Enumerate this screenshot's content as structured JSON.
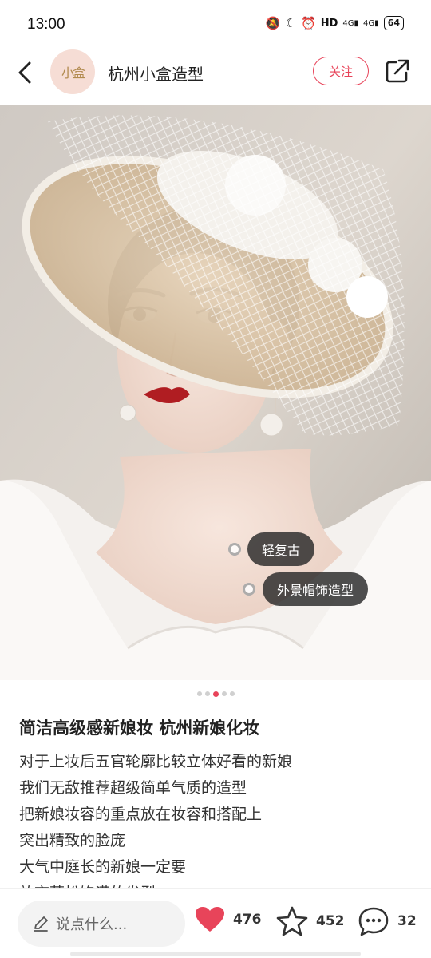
{
  "status_bar": {
    "time": "13:00",
    "network": "HD",
    "signal_1": "4G",
    "signal_2": "4G",
    "battery": "64"
  },
  "header": {
    "account_name": "杭州小盒造型",
    "avatar_text": "小盒",
    "follow_label": "关注"
  },
  "photo": {
    "tags": [
      {
        "label": "轻复古"
      },
      {
        "label": "外景帽饰造型"
      }
    ],
    "pager": {
      "count": 5,
      "active_index": 2
    }
  },
  "post": {
    "title": "简洁高级感新娘妆 杭州新娘化妆",
    "lines": [
      "对于上妆后五官轮廓比较立体好看的新娘",
      "我们无敌推荐超级简单气质的造型",
      "把新娘妆容的重点放在妆容和搭配上",
      "突出精致的脸庞",
      "大气中庭长的新娘一定要",
      "放弃蓬松饱满的发型"
    ]
  },
  "bottom_bar": {
    "comment_placeholder": "说点什么...",
    "likes": "476",
    "favorites": "452",
    "comments": "32"
  },
  "colors": {
    "accent": "#e8445a",
    "tag_bg": "#2a2a2a"
  }
}
